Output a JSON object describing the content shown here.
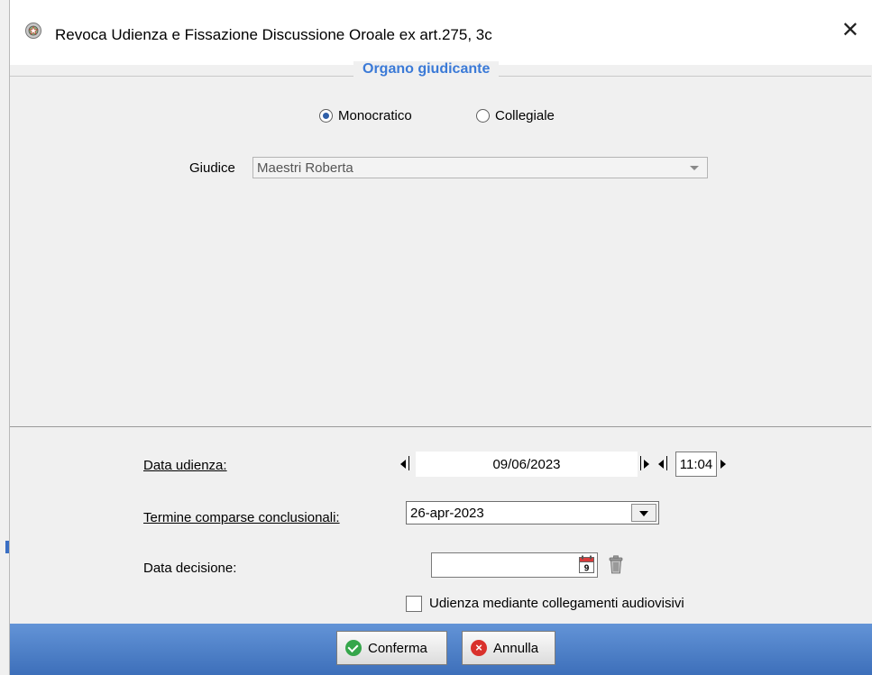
{
  "window": {
    "title": "Revoca Udienza e Fissazione Discussione Oroale ex art.275, 3c",
    "close_glyph": "✕",
    "icon": "emblem-icon"
  },
  "panel": {
    "legend": "Organo giudicante",
    "radio_options": [
      {
        "label": "Monocratico",
        "selected": true
      },
      {
        "label": "Collegiale",
        "selected": false
      }
    ],
    "giudice_label": "Giudice",
    "giudice_value": "Maestri Roberta"
  },
  "form": {
    "data_udienza_label": "Data udienza:",
    "data_udienza_value": "09/06/2023",
    "ora_udienza_value": "11:04",
    "termine_label": "Termine comparse conclusionali:",
    "termine_value": "26-apr-2023",
    "data_decisione_label": "Data decisione:",
    "data_decisione_value": "",
    "calendar_icon_day": "9",
    "audiovisivi_label": "Udienza mediante collegamenti audiovisivi",
    "audiovisivi_checked": false
  },
  "footer": {
    "conferma_label": "Conferma",
    "annulla_label": "Annulla"
  },
  "colors": {
    "accent": "#3b7ad7",
    "footer_top": "#6394d7",
    "footer_bottom": "#3d6fba",
    "ok": "#35a64b",
    "cancel": "#d9312c"
  }
}
